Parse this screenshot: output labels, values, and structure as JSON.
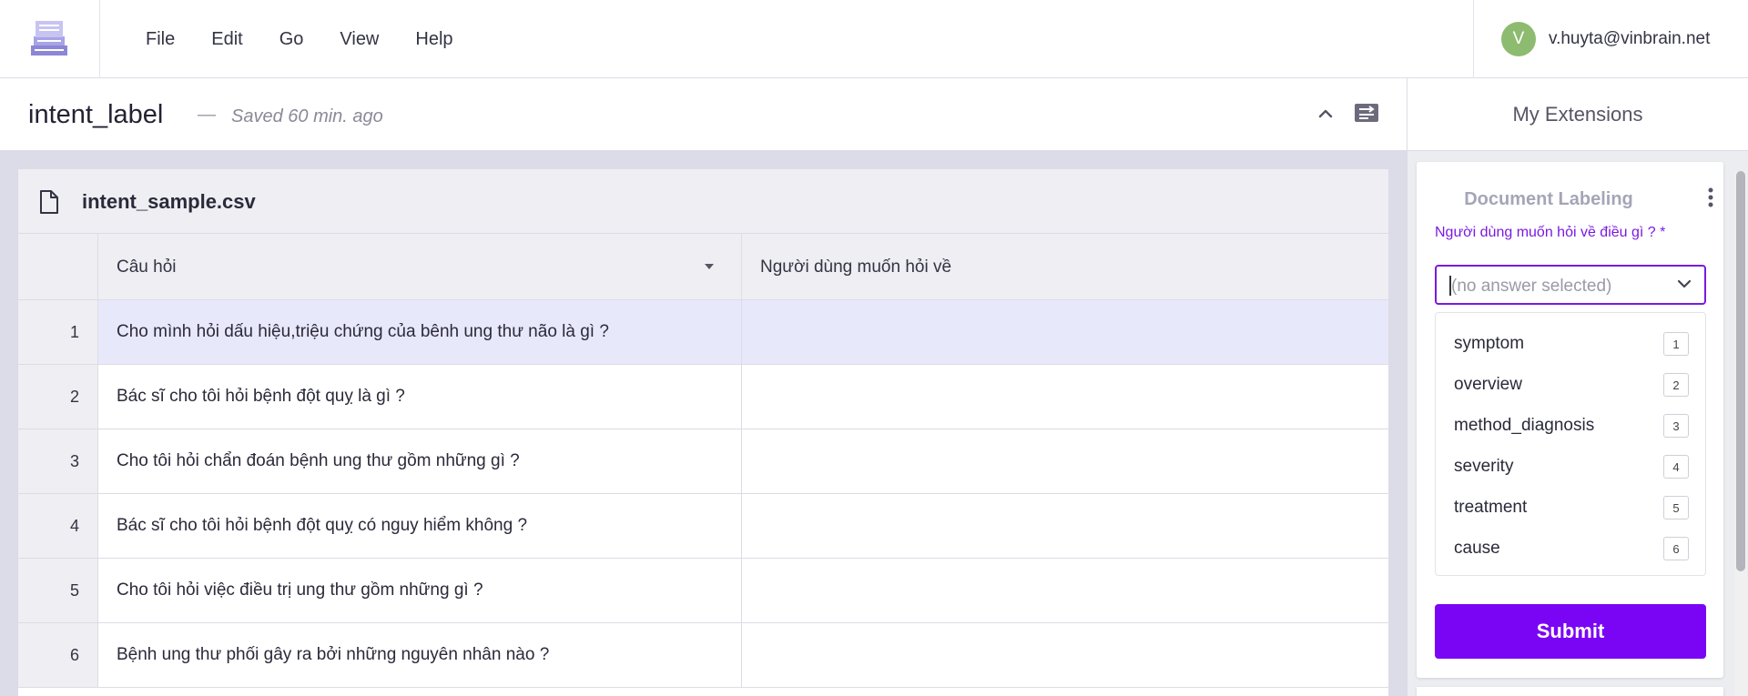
{
  "menubar": {
    "items": [
      "File",
      "Edit",
      "Go",
      "View",
      "Help"
    ],
    "user": {
      "avatar_initial": "V",
      "email": "v.huyta@vinbrain.net"
    }
  },
  "project": {
    "title": "intent_label",
    "separator": "—",
    "saved_status": "Saved 60 min. ago"
  },
  "extensions": {
    "title": "My Extensions"
  },
  "file": {
    "name": "intent_sample.csv",
    "columns": [
      "Câu hỏi",
      "Người dùng muốn hỏi về"
    ],
    "rows": [
      {
        "index": "1",
        "question": "Cho mình hỏi dấu hiệu,triệu chứng của bênh ung thư não là gì ?",
        "answer": ""
      },
      {
        "index": "2",
        "question": "Bác sĩ cho tôi hỏi bệnh đột quỵ là gì ?",
        "answer": ""
      },
      {
        "index": "3",
        "question": "Cho tôi hỏi chẩn đoán bệnh ung thư gồm những gì ?",
        "answer": ""
      },
      {
        "index": "4",
        "question": "Bác sĩ cho tôi hỏi bệnh đột quỵ có nguy hiểm không ?",
        "answer": ""
      },
      {
        "index": "5",
        "question": "Cho tôi hỏi việc điều trị ung thư gồm những gì ?",
        "answer": ""
      },
      {
        "index": "6",
        "question": "Bệnh ung thư phối gây ra bởi những nguyên nhân nào ?",
        "answer": ""
      }
    ],
    "selected_row": "1"
  },
  "labeling": {
    "title": "Document Labeling",
    "question": "Người dùng muốn hỏi về điều gì ? *",
    "placeholder": "(no answer selected)",
    "options": [
      {
        "label": "symptom",
        "key": "1"
      },
      {
        "label": "overview",
        "key": "2"
      },
      {
        "label": "method_diagnosis",
        "key": "3"
      },
      {
        "label": "severity",
        "key": "4"
      },
      {
        "label": "treatment",
        "key": "5"
      },
      {
        "label": "cause",
        "key": "6"
      }
    ],
    "submit_label": "Submit"
  },
  "colors": {
    "accent": "#7a05f5",
    "question_label": "#7a19e0",
    "selected_row": "#e8e8fb",
    "avatar": "#8dbb6f"
  }
}
